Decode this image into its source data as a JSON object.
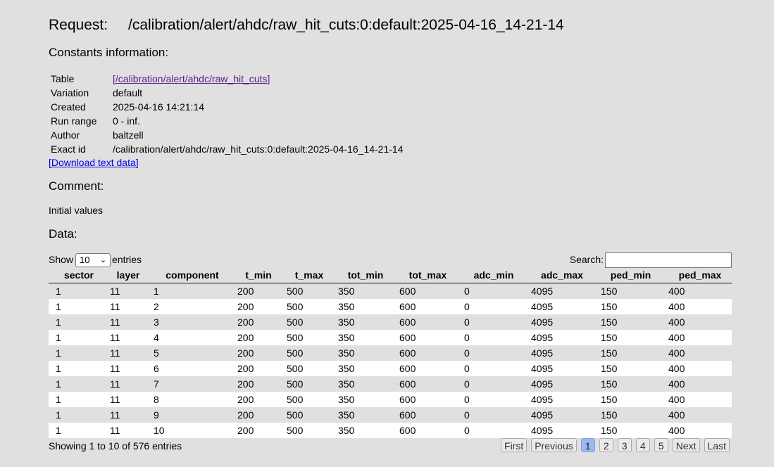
{
  "request": {
    "label": "Request:",
    "path": "/calibration/alert/ahdc/raw_hit_cuts:0:default:2025-04-16_14-21-14"
  },
  "constants": {
    "heading": "Constants information:",
    "rows": [
      {
        "key": "Table",
        "value": "[/calibration/alert/ahdc/raw_hit_cuts]"
      },
      {
        "key": "Variation",
        "value": "default"
      },
      {
        "key": "Created",
        "value": "2025-04-16 14:21:14"
      },
      {
        "key": "Run range",
        "value": "0 - inf."
      },
      {
        "key": "Author",
        "value": "baltzell"
      },
      {
        "key": "Exact id",
        "value": "/calibration/alert/ahdc/raw_hit_cuts:0:default:2025-04-16_14-21-14"
      }
    ],
    "download_label": "[Download text data]"
  },
  "comment": {
    "heading": "Comment:",
    "text": "Initial values"
  },
  "data_section": {
    "heading": "Data:",
    "length": {
      "show_label": "Show",
      "selected": "10",
      "entries_label": "entries"
    },
    "search": {
      "label": "Search:",
      "value": ""
    },
    "columns": [
      "sector",
      "layer",
      "component",
      "t_min",
      "t_max",
      "tot_min",
      "tot_max",
      "adc_min",
      "adc_max",
      "ped_min",
      "ped_max"
    ],
    "rows": [
      [
        "1",
        "11",
        "1",
        "200",
        "500",
        "350",
        "600",
        "0",
        "4095",
        "150",
        "400"
      ],
      [
        "1",
        "11",
        "2",
        "200",
        "500",
        "350",
        "600",
        "0",
        "4095",
        "150",
        "400"
      ],
      [
        "1",
        "11",
        "3",
        "200",
        "500",
        "350",
        "600",
        "0",
        "4095",
        "150",
        "400"
      ],
      [
        "1",
        "11",
        "4",
        "200",
        "500",
        "350",
        "600",
        "0",
        "4095",
        "150",
        "400"
      ],
      [
        "1",
        "11",
        "5",
        "200",
        "500",
        "350",
        "600",
        "0",
        "4095",
        "150",
        "400"
      ],
      [
        "1",
        "11",
        "6",
        "200",
        "500",
        "350",
        "600",
        "0",
        "4095",
        "150",
        "400"
      ],
      [
        "1",
        "11",
        "7",
        "200",
        "500",
        "350",
        "600",
        "0",
        "4095",
        "150",
        "400"
      ],
      [
        "1",
        "11",
        "8",
        "200",
        "500",
        "350",
        "600",
        "0",
        "4095",
        "150",
        "400"
      ],
      [
        "1",
        "11",
        "9",
        "200",
        "500",
        "350",
        "600",
        "0",
        "4095",
        "150",
        "400"
      ],
      [
        "1",
        "11",
        "10",
        "200",
        "500",
        "350",
        "600",
        "0",
        "4095",
        "150",
        "400"
      ]
    ],
    "info": "Showing 1 to 10 of 576 entries",
    "pager": {
      "first": "First",
      "previous": "Previous",
      "pages": [
        "1",
        "2",
        "3",
        "4",
        "5"
      ],
      "current": "1",
      "next": "Next",
      "last": "Last"
    }
  }
}
